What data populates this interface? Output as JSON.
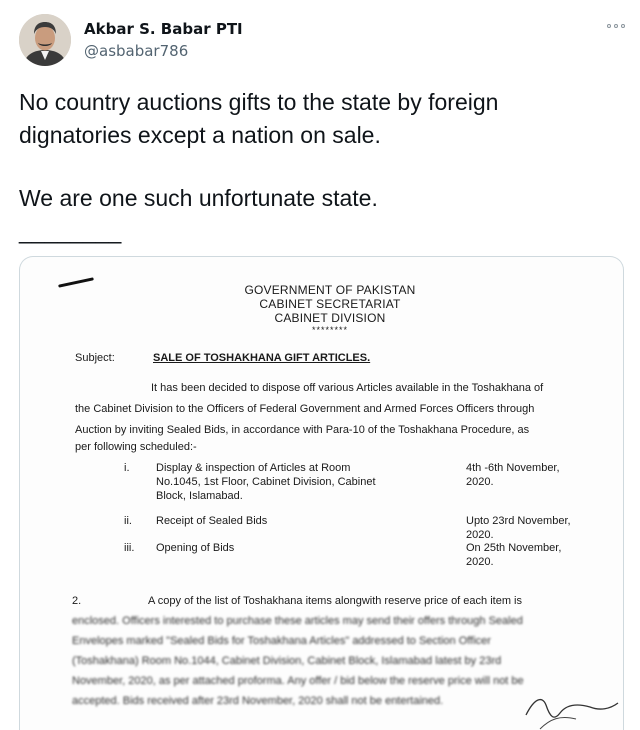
{
  "author": {
    "name": "Akbar S. Babar PTI",
    "handle": "@asbabar786",
    "avatar": "profile-photo"
  },
  "menu_icon": "more-options-icon",
  "tweet": {
    "line1": "No country auctions gifts to the state by foreign",
    "line2": "dignatories except a nation on sale.",
    "line3": "We are one such unfortunate state.",
    "line4": "________"
  },
  "document": {
    "header1": "GOVERNMENT OF PAKISTAN",
    "header2": "CABINET SECRETARIAT",
    "header3": "CABINET DIVISION",
    "header_stars": "********",
    "subject_label": "Subject:",
    "subject_title": "SALE OF TOSHAKHANA GIFT ARTICLES.",
    "para1_line1": "It has been decided to dispose off various Articles available in the Toshakhana of",
    "para1_line2": "the Cabinet Division to the Officers of Federal Government and Armed Forces Officers through",
    "para1_line3": "Auction by inviting Sealed Bids, in accordance with Para-10 of the Toshakhana Procedure, as",
    "para1_line4": "per following scheduled:-",
    "items": [
      {
        "num": "i.",
        "line1": "Display  &  inspection  of  Articles  at  Room",
        "line2": "No.1045,  1st  Floor,  Cabinet  Division,  Cabinet",
        "line3": "Block, Islamabad.",
        "date1": "4th  -6th  November,",
        "date2": "2020."
      },
      {
        "num": "ii.",
        "line1": "Receipt of Sealed Bids",
        "date1": "Upto 23rd November,",
        "date2": "2020."
      },
      {
        "num": "iii.",
        "line1": "Opening of Bids",
        "date1": "On  25th  November,",
        "date2": "2020."
      }
    ],
    "para2_num": "2.",
    "para2_line1": "A copy of the list of Toshakhana items alongwith reserve price of each item is",
    "para2_line2": "enclosed. Officers interested to purchase these articles may send their offers through Sealed",
    "para2_line3": "Envelopes marked \"Sealed Bids for Toshakhana Articles\" addressed to Section Officer",
    "para2_line4": "(Toshakhana) Room No.1044, Cabinet Division, Cabinet Block, Islamabad latest by 23rd",
    "para2_line5": "November, 2020, as per attached proforma. Any offer / bid below the reserve price will not be",
    "para2_line6": "accepted. Bids received after 23rd November, 2020 shall not be entertained."
  }
}
